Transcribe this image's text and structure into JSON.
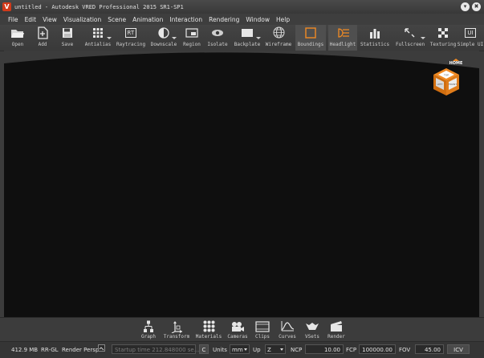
{
  "window": {
    "title": "untitled - Autodesk VRED Professional 2015 SR1-SP1",
    "logo_letter": "V",
    "controls": {
      "minimize": "▾",
      "close": "✖"
    }
  },
  "menu": [
    "File",
    "Edit",
    "View",
    "Visualization",
    "Scene",
    "Animation",
    "Interaction",
    "Rendering",
    "Window",
    "Help"
  ],
  "toolbar": {
    "rt_badge": "RT",
    "ui_badge": "UI",
    "items": [
      {
        "label": "Open",
        "icon": "folder-open-icon"
      },
      {
        "label": "Add",
        "icon": "add-file-icon"
      },
      {
        "label": "Save",
        "icon": "save-disk-icon"
      },
      {
        "label": "Antialias",
        "icon": "antialias-grid-icon"
      },
      {
        "label": "Raytracing",
        "icon": "raytracing-rt-icon"
      },
      {
        "label": "Downscale",
        "icon": "downscale-half-circle-icon"
      },
      {
        "label": "Region",
        "icon": "region-rect-icon"
      },
      {
        "label": "Isolate",
        "icon": "isolate-eye-icon"
      },
      {
        "label": "Backplate",
        "icon": "backplate-icon"
      },
      {
        "label": "Wireframe",
        "icon": "wireframe-globe-icon"
      },
      {
        "label": "Boundings",
        "icon": "boundings-box-icon"
      },
      {
        "label": "Headlight",
        "icon": "headlight-icon"
      },
      {
        "label": "Statistics",
        "icon": "statistics-bars-icon"
      },
      {
        "label": "Fullscreen",
        "icon": "fullscreen-arrows-icon"
      },
      {
        "label": "Texturing",
        "icon": "texturing-checker-icon"
      },
      {
        "label": "Simple UI",
        "icon": "simple-ui-icon"
      }
    ]
  },
  "navcube": {
    "label": "HOME",
    "faces": [
      "TOP",
      "LEFT",
      "FRONT"
    ],
    "accent": "#f08a24"
  },
  "dock": [
    {
      "label": "Graph",
      "icon": "graph-tree-icon"
    },
    {
      "label": "Transform",
      "icon": "transform-axes-icon"
    },
    {
      "label": "Materials",
      "icon": "materials-spheres-icon"
    },
    {
      "label": "Cameras",
      "icon": "camera-icon"
    },
    {
      "label": "Clips",
      "icon": "clips-film-icon"
    },
    {
      "label": "Curves",
      "icon": "curves-icon"
    },
    {
      "label": "VSets",
      "icon": "vsets-icon"
    },
    {
      "label": "Render",
      "icon": "render-clapper-icon"
    }
  ],
  "status": {
    "memory": "412.9 MB",
    "renderer": "RR-GL",
    "render_mode": "Render Persp",
    "startup_time": "Startup time 212.848000 se...",
    "c_button": "C",
    "units_label": "Units",
    "units_value": "mm",
    "up_label": "Up",
    "up_value": "Z",
    "ncp_label": "NCP",
    "ncp_value": "10.00",
    "fcp_label": "FCP",
    "fcp_value": "100000.00",
    "fov_label": "FOV",
    "fov_value": "45.00",
    "icv_button": "ICV"
  },
  "colors": {
    "viewport": "#0f0f0f",
    "panel": "#3c3c3c",
    "accent": "#f08a24"
  }
}
